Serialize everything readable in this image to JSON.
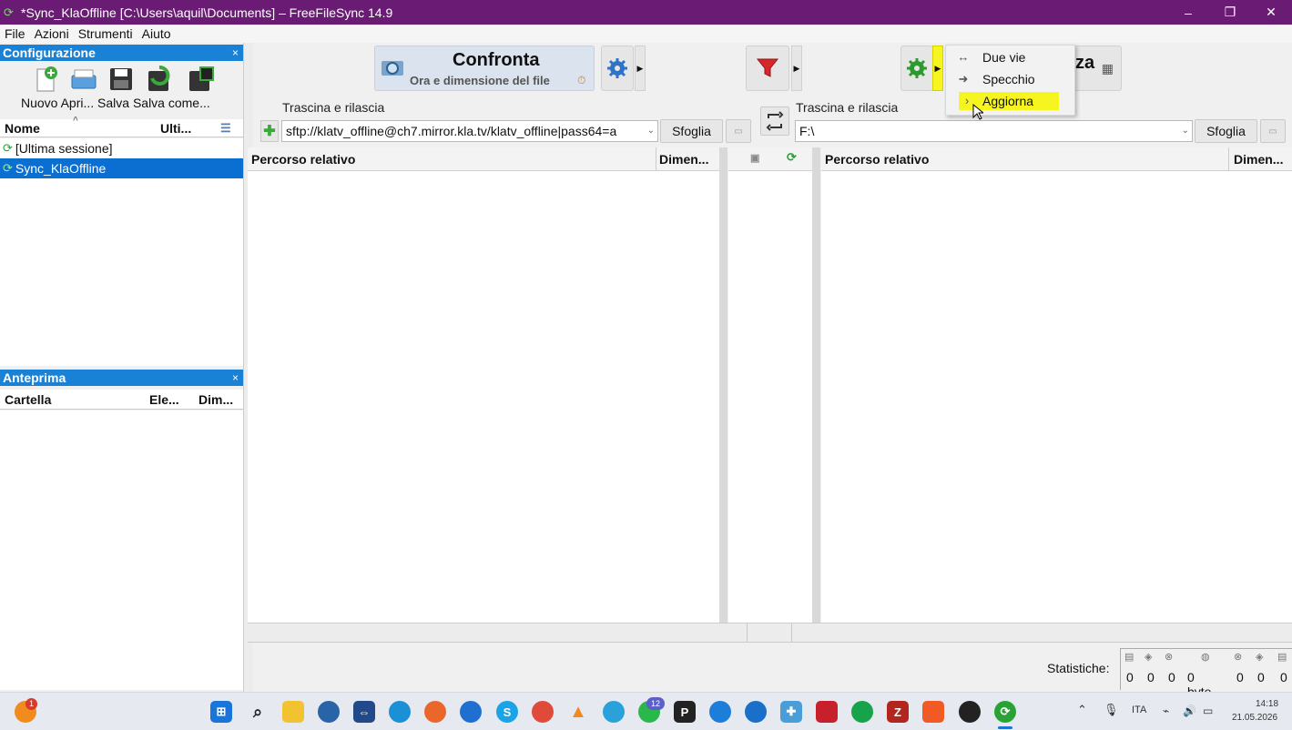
{
  "window": {
    "title": "*Sync_KlaOffline [C:\\Users\\aquil\\Documents] – FreeFileSync 14.9",
    "minimize": "–",
    "maximize": "❐",
    "close": "✕"
  },
  "menu": [
    "File",
    "Azioni",
    "Strumenti",
    "Aiuto"
  ],
  "config_panel": {
    "title": "Configurazione",
    "close": "×",
    "tool_labels": "Nuovo Apri... Salva Salva come...",
    "col_name": "Nome",
    "col_last": "Ulti...",
    "items": [
      "[Ultima sessione]",
      "Sync_KlaOffline"
    ]
  },
  "preview_panel": {
    "title": "Anteprima",
    "close": "×",
    "col_folder": "Cartella",
    "col_items": "Ele...",
    "col_size": "Dim..."
  },
  "toolbar": {
    "compare_title": "Confronta",
    "compare_sub": "Ora e dimensione del file",
    "sync_partial": "za"
  },
  "left_folder": {
    "drop_label": "Trascina e rilascia",
    "path": "sftp://klatv_offline@ch7.mirror.kla.tv/klatv_offline|pass64=a",
    "browse": "Sfoglia"
  },
  "right_folder": {
    "drop_label": "Trascina e rilascia",
    "path": "F:\\",
    "browse": "Sfoglia"
  },
  "grid": {
    "left_col_path": "Percorso relativo",
    "left_col_size": "Dimen...",
    "right_col_path": "Percorso relativo",
    "right_col_size": "Dimen..."
  },
  "stats": {
    "label": "Statistiche:",
    "values": [
      "0",
      "0",
      "0",
      "0 byte",
      "0",
      "0",
      "0"
    ]
  },
  "sync_menu": {
    "items": [
      {
        "icon": "↔",
        "label": "Due vie"
      },
      {
        "icon": "➜",
        "label": "Specchio"
      },
      {
        "icon": "›",
        "label": "Aggiorna"
      }
    ],
    "highlight_color": "#f7f520"
  },
  "taskbar": {
    "notification_badge": "1",
    "whatsapp_badge": "12",
    "tray_lang": "ITA",
    "time": "14:18",
    "date": "21.05.2026"
  },
  "colors": {
    "titlebar": "#6a1b73",
    "panel_header": "#1a82d6",
    "selection": "#0a6fd0"
  }
}
